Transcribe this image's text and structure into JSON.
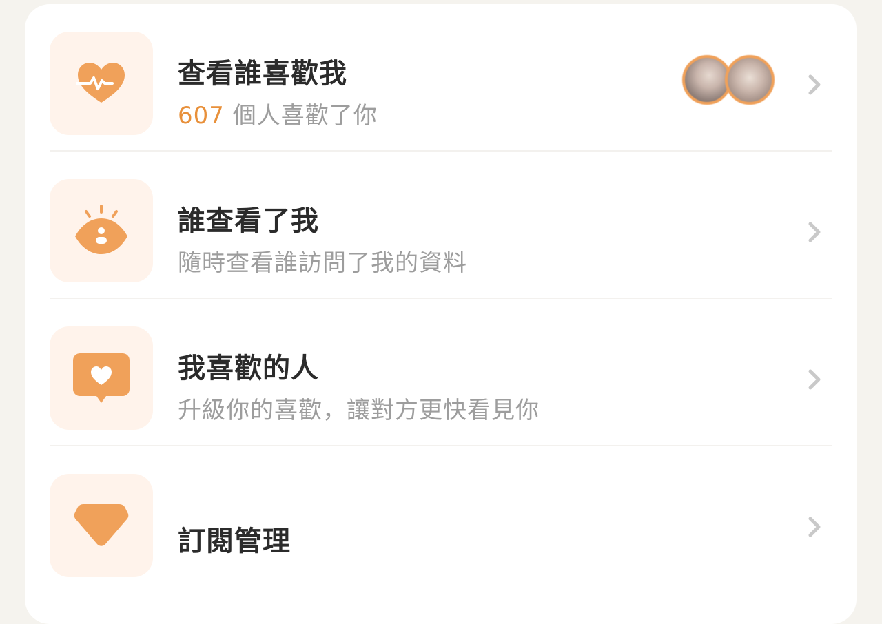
{
  "menu": {
    "items": [
      {
        "title": "查看誰喜歡我",
        "count": "607",
        "subtitle": " 個人喜歡了你",
        "icon": "heartbeat-icon"
      },
      {
        "title": "誰查看了我",
        "subtitle": "隨時查看誰訪問了我的資料",
        "icon": "eye-icon"
      },
      {
        "title": "我喜歡的人",
        "subtitle": "升級你的喜歡，讓對方更快看見你",
        "icon": "heart-message-icon"
      },
      {
        "title": "訂閱管理",
        "icon": "diamond-icon"
      }
    ]
  },
  "colors": {
    "accent": "#f0a15a",
    "icon_bg": "#fff3eb",
    "count": "#e8903a",
    "title": "#2b2b2b",
    "subtitle": "#9d9d9d"
  }
}
